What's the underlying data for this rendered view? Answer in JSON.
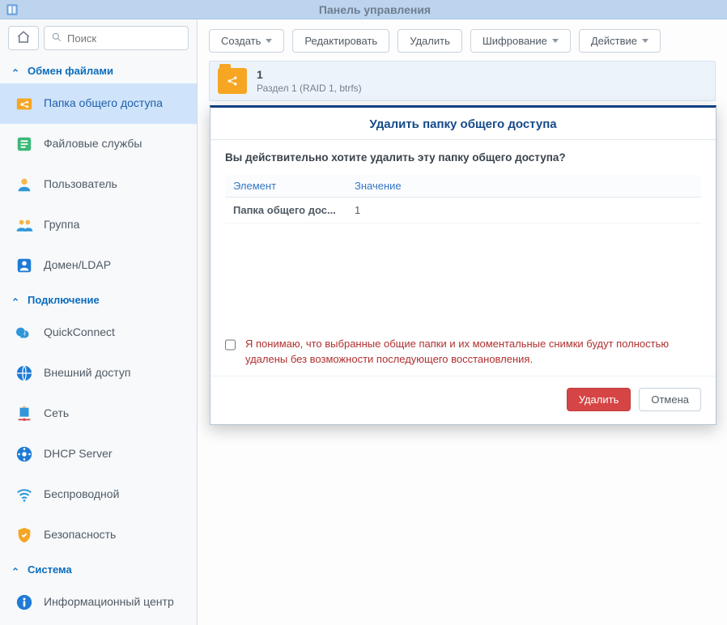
{
  "window": {
    "title": "Панель управления"
  },
  "search": {
    "placeholder": "Поиск"
  },
  "sidebar": {
    "sections": [
      {
        "label": "Обмен файлами",
        "items": [
          {
            "label": "Папка общего доступа",
            "icon": "share-folder-icon",
            "active": true
          },
          {
            "label": "Файловые службы",
            "icon": "file-services-icon"
          },
          {
            "label": "Пользователь",
            "icon": "user-icon"
          },
          {
            "label": "Группа",
            "icon": "group-icon"
          },
          {
            "label": "Домен/LDAP",
            "icon": "domain-icon"
          }
        ]
      },
      {
        "label": "Подключение",
        "items": [
          {
            "label": "QuickConnect",
            "icon": "quickconnect-icon"
          },
          {
            "label": "Внешний доступ",
            "icon": "external-access-icon"
          },
          {
            "label": "Сеть",
            "icon": "network-icon"
          },
          {
            "label": "DHCP Server",
            "icon": "dhcp-icon"
          },
          {
            "label": "Беспроводной",
            "icon": "wifi-icon"
          },
          {
            "label": "Безопасность",
            "icon": "security-icon"
          }
        ]
      },
      {
        "label": "Система",
        "items": [
          {
            "label": "Информационный центр",
            "icon": "info-icon"
          }
        ]
      }
    ]
  },
  "toolbar": {
    "create": "Создать",
    "edit": "Редактировать",
    "delete": "Удалить",
    "encryption": "Шифрование",
    "action": "Действие"
  },
  "folder": {
    "name": "1",
    "desc": "Раздел 1 (RAID 1, btrfs)"
  },
  "modal": {
    "title": "Удалить папку общего доступа",
    "question": "Вы действительно хотите удалить эту папку общего доступа?",
    "col_element": "Элемент",
    "col_value": "Значение",
    "row_element": "Папка общего дос...",
    "row_value": "1",
    "ack": "Я понимаю, что выбранные общие папки и их моментальные снимки будут полностью удалены без возможности последующего восстановления.",
    "delete": "Удалить",
    "cancel": "Отмена"
  }
}
